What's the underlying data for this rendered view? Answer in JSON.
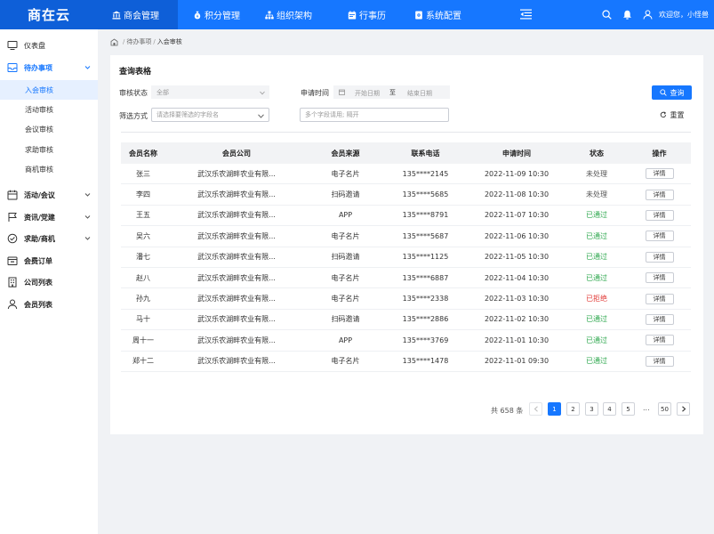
{
  "header": {
    "logo": "商在云",
    "nav": [
      {
        "label": "商会管理",
        "icon": "bank-icon"
      },
      {
        "label": "积分管理",
        "icon": "money-bag-icon"
      },
      {
        "label": "组织架构",
        "icon": "org-chart-icon"
      },
      {
        "label": "行事历",
        "icon": "calendar-icon"
      },
      {
        "label": "系统配置",
        "icon": "settings-doc-icon"
      }
    ],
    "welcome": "欢迎您，小怪兽"
  },
  "sidebar": {
    "items": [
      {
        "label": "仪表盘",
        "icon": "dashboard-icon"
      },
      {
        "label": "待办事项",
        "icon": "inbox-icon"
      },
      {
        "label": "活动/会议",
        "icon": "calendar-icon"
      },
      {
        "label": "资讯/党建",
        "icon": "flag-icon"
      },
      {
        "label": "求助/商机",
        "icon": "check-circle-icon"
      },
      {
        "label": "会费订单",
        "icon": "wallet-icon"
      },
      {
        "label": "公司列表",
        "icon": "building-icon"
      },
      {
        "label": "会员列表",
        "icon": "user-icon"
      }
    ],
    "sub_items": [
      "入会审核",
      "活动审核",
      "会议审核",
      "求助审核",
      "商机审核"
    ]
  },
  "breadcrumb": [
    "待办事项",
    "入会审核"
  ],
  "form": {
    "title": "查询表格",
    "status_label": "审核状态",
    "status_value": "全部",
    "time_label": "申请时间",
    "start_placeholder": "开始日期",
    "date_separator": "至",
    "end_placeholder": "结束日期",
    "filter_label": "筛选方式",
    "filter_placeholder": "请选择要筛选的字段名",
    "multi_placeholder": "多个字段请用; 隔开",
    "search_label": "查询",
    "reset_label": "重置"
  },
  "table": {
    "headers": [
      "会员名称",
      "会员公司",
      "会员来源",
      "联系电话",
      "申请时间",
      "状态",
      "操作"
    ],
    "action_label": "详情",
    "rows": [
      {
        "name": "张三",
        "company": "武汉乐农湖畔农业有限...",
        "source": "电子名片",
        "phone": "135****2145",
        "time": "2022-11-09 10:30",
        "status": "未处理",
        "status_color": "#555555"
      },
      {
        "name": "李四",
        "company": "武汉乐农湖畔农业有限...",
        "source": "扫码邀请",
        "phone": "135****5685",
        "time": "2022-11-08 10:30",
        "status": "未处理",
        "status_color": "#555555"
      },
      {
        "name": "王五",
        "company": "武汉乐农湖畔农业有限...",
        "source": "APP",
        "phone": "135****8791",
        "time": "2022-11-07 10:30",
        "status": "已通过",
        "status_color": "#2fa84f"
      },
      {
        "name": "吴六",
        "company": "武汉乐农湖畔农业有限...",
        "source": "电子名片",
        "phone": "135****5687",
        "time": "2022-11-06 10:30",
        "status": "已通过",
        "status_color": "#2fa84f"
      },
      {
        "name": "潘七",
        "company": "武汉乐农湖畔农业有限...",
        "source": "扫码邀请",
        "phone": "135****1125",
        "time": "2022-11-05 10:30",
        "status": "已通过",
        "status_color": "#2fa84f"
      },
      {
        "name": "赵八",
        "company": "武汉乐农湖畔农业有限...",
        "source": "电子名片",
        "phone": "135****6887",
        "time": "2022-11-04 10:30",
        "status": "已通过",
        "status_color": "#2fa84f"
      },
      {
        "name": "孙九",
        "company": "武汉乐农湖畔农业有限...",
        "source": "电子名片",
        "phone": "135****2338",
        "time": "2022-11-03 10:30",
        "status": "已拒绝",
        "status_color": "#e23c39"
      },
      {
        "name": "马十",
        "company": "武汉乐农湖畔农业有限...",
        "source": "扫码邀请",
        "phone": "135****2886",
        "time": "2022-11-02 10:30",
        "status": "已通过",
        "status_color": "#2fa84f"
      },
      {
        "name": "周十一",
        "company": "武汉乐农湖畔农业有限...",
        "source": "APP",
        "phone": "135****3769",
        "time": "2022-11-01 10:30",
        "status": "已通过",
        "status_color": "#2fa84f"
      },
      {
        "name": "郑十二",
        "company": "武汉乐农湖畔农业有限...",
        "source": "电子名片",
        "phone": "135****1478",
        "time": "2022-11-01 09:30",
        "status": "已通过",
        "status_color": "#2fa84f"
      }
    ]
  },
  "pagination": {
    "total": "共 658 条",
    "pages": [
      "1",
      "2",
      "3",
      "4",
      "5"
    ],
    "current": "1",
    "ellipsis": "...",
    "last": "50"
  },
  "colors": {
    "primary": "#1677ff",
    "header_dark": "#0e5fd8"
  }
}
